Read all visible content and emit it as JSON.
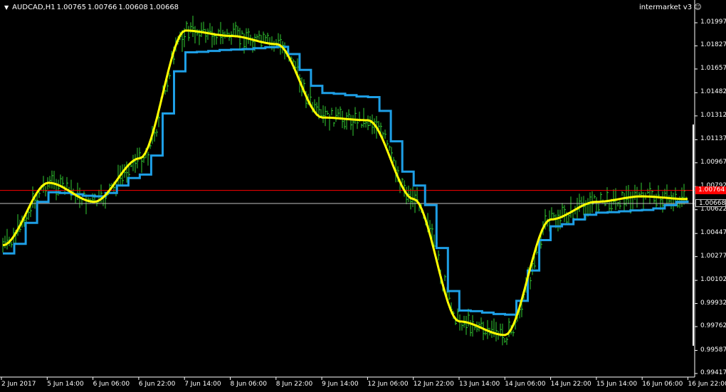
{
  "header": {
    "symbol": "AUDCAD,H1",
    "open": "1.00765",
    "high": "1.00766",
    "low": "1.00608",
    "close": "1.00668"
  },
  "indicator": {
    "label": "intermarket v3",
    "icon": "smiley-icon"
  },
  "price_axis": {
    "labels": [
      "1.01997",
      "1.01827",
      "1.01657",
      "1.01482",
      "1.01312",
      "1.01137",
      "1.00967",
      "1.00792",
      "1.00622",
      "1.00447",
      "1.00277",
      "1.00102",
      "0.99932",
      "0.99762",
      "0.99587",
      "0.99417"
    ],
    "ask_tag": "1.00764",
    "bid_tag": "1.00668"
  },
  "time_axis": {
    "labels": [
      "2 Jun 2017",
      "5 Jun 14:00",
      "6 Jun 06:00",
      "6 Jun 22:00",
      "7 Jun 14:00",
      "8 Jun 06:00",
      "8 Jun 22:00",
      "9 Jun 14:00",
      "12 Jun 06:00",
      "12 Jun 22:00",
      "13 Jun 14:00",
      "14 Jun 06:00",
      "14 Jun 22:00",
      "15 Jun 14:00",
      "16 Jun 06:00",
      "16 Jun 22:00"
    ]
  },
  "colors": {
    "background": "#000000",
    "bars": "#32cd32",
    "yellow_line": "#ffff00",
    "blue_line": "#1e9fe6",
    "ask_line": "#ff0000",
    "bid_line": "#c0c0c0",
    "axis": "#ffffff"
  },
  "chart_data": {
    "type": "line",
    "title": "AUDCAD,H1",
    "series": [
      {
        "name": "",
        "color": "yellow",
        "x": [
          "2 Jun 2017",
          "5 Jun 14:00",
          "6 Jun 06:00",
          "6 Jun 22:00",
          "7 Jun 14:00",
          "8 Jun 06:00",
          "8 Jun 22:00",
          "9 Jun 14:00",
          "12 Jun 06:00",
          "12 Jun 22:00",
          "13 Jun 14:00",
          "14 Jun 06:00",
          "14 Jun 22:00",
          "15 Jun 14:00",
          "16 Jun 06:00",
          "16 Jun 22:00"
        ],
        "y": [
          1.0036,
          1.0082,
          1.0068,
          1.01,
          1.0194,
          1.019,
          1.0184,
          1.013,
          1.0128,
          1.007,
          0.998,
          0.997,
          1.0055,
          1.0068,
          1.0072,
          1.007
        ]
      },
      {
        "name": "",
        "color": "blue",
        "x": [
          "2 Jun 2017",
          "5 Jun 14:00",
          "6 Jun 06:00",
          "6 Jun 22:00",
          "7 Jun 14:00",
          "8 Jun 06:00",
          "8 Jun 22:00",
          "9 Jun 14:00",
          "12 Jun 06:00",
          "12 Jun 22:00",
          "13 Jun 14:00",
          "14 Jun 06:00",
          "14 Jun 22:00",
          "15 Jun 14:00",
          "16 Jun 06:00",
          "16 Jun 22:00"
        ],
        "y": [
          1.003,
          1.0075,
          1.0072,
          1.0088,
          1.0178,
          1.018,
          1.0182,
          1.0148,
          1.0145,
          1.008,
          0.9988,
          0.9985,
          1.005,
          1.006,
          1.0062,
          1.0069
        ]
      }
    ],
    "ylim": [
      0.99417,
      1.0207
    ],
    "ask": 1.00764,
    "bid": 1.00668,
    "grid": false,
    "legend": "none"
  }
}
